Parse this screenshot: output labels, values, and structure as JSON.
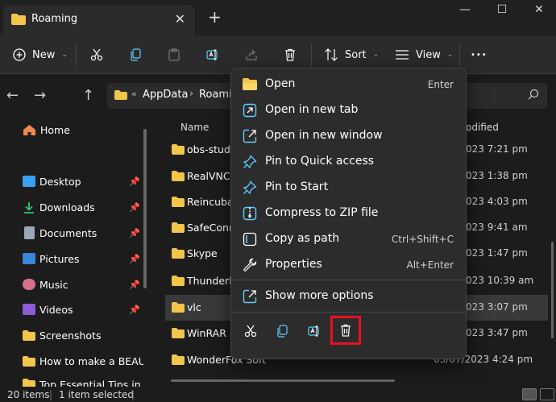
{
  "window": {
    "tab_title": "Roaming",
    "tab_close": "✕",
    "new_tab": "+",
    "minimize": "—",
    "maximize": "☐",
    "close": "✕"
  },
  "toolbar": {
    "new_label": "New",
    "sort_label": "Sort",
    "view_label": "View",
    "more": "•••"
  },
  "address": {
    "overflow": "«",
    "crumbs": [
      "AppData",
      "Roaming"
    ],
    "separator": "›"
  },
  "sidebar": {
    "home": "Home",
    "items": [
      {
        "label": "Desktop",
        "icon": "desktop-icon",
        "color": "#3aa0f0",
        "pinned": true
      },
      {
        "label": "Downloads",
        "icon": "download-icon",
        "color": "#2ec27e",
        "pinned": true
      },
      {
        "label": "Documents",
        "icon": "document-icon",
        "color": "#9aa7b8",
        "pinned": true
      },
      {
        "label": "Pictures",
        "icon": "pictures-icon",
        "color": "#3a86d8",
        "pinned": true
      },
      {
        "label": "Music",
        "icon": "music-icon",
        "color": "#d8708a",
        "pinned": true
      },
      {
        "label": "Videos",
        "icon": "videos-icon",
        "color": "#8a5cd8",
        "pinned": true
      },
      {
        "label": "Screenshots",
        "icon": "folder-icon",
        "color": "#f2c54b",
        "pinned": false
      },
      {
        "label": "How to make a BEAUTII",
        "icon": "folder-icon",
        "color": "#f2c54b",
        "pinned": false
      },
      {
        "label": "Top Essential Tips in ho",
        "icon": "folder-icon",
        "color": "#f2c54b",
        "pinned": false
      }
    ]
  },
  "files": {
    "col_name": "Name",
    "col_date": "odified",
    "rows": [
      {
        "name": "obs-studio",
        "date": "023 7:21 pm"
      },
      {
        "name": "RealVNC",
        "date": "023 1:38 pm"
      },
      {
        "name": "Reincubat",
        "date": "023 4:03 pm"
      },
      {
        "name": "SafeConne",
        "date": "023 9:41 am"
      },
      {
        "name": "Skype",
        "date": "023 1:47 pm"
      },
      {
        "name": "Thunderbi",
        "date": "023 10:39 am"
      },
      {
        "name": "vlc",
        "date": "023 3:07 pm",
        "selected": true
      },
      {
        "name": "WinRAR",
        "date": "023 3:47 pm"
      },
      {
        "name": "WonderFox Soft",
        "date": "05/07/2023 4:24 pm"
      }
    ]
  },
  "status": {
    "items": "20 items",
    "selected": "1 item selected"
  },
  "context_menu": {
    "items": [
      {
        "label": "Open",
        "shortcut": "Enter",
        "icon": "folder-open-icon"
      },
      {
        "label": "Open in new tab",
        "shortcut": "",
        "icon": "new-tab-icon"
      },
      {
        "label": "Open in new window",
        "shortcut": "",
        "icon": "new-window-icon"
      },
      {
        "label": "Pin to Quick access",
        "shortcut": "",
        "icon": "pin-icon"
      },
      {
        "label": "Pin to Start",
        "shortcut": "",
        "icon": "pin-start-icon"
      },
      {
        "label": "Compress to ZIP file",
        "shortcut": "",
        "icon": "zip-icon"
      },
      {
        "label": "Copy as path",
        "shortcut": "Ctrl+Shift+C",
        "icon": "copy-path-icon"
      },
      {
        "label": "Properties",
        "shortcut": "Alt+Enter",
        "icon": "wrench-icon"
      }
    ],
    "more_options": "Show more options",
    "highlight_color": "#e81123"
  },
  "colors": {
    "folder": "#f2c54b",
    "accent": "#60cdff"
  }
}
